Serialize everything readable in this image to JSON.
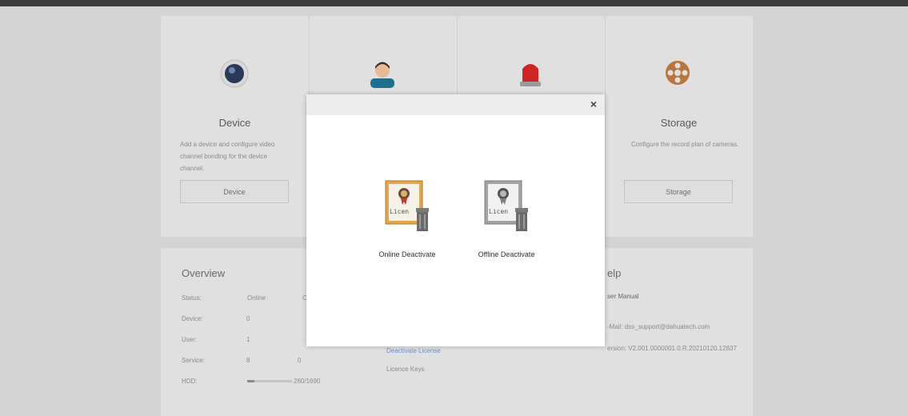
{
  "cards": [
    {
      "title": "Device",
      "desc": "Add a device and configure video channel bonding for the device channel.",
      "button": "Device",
      "icon": "camera-icon"
    },
    {
      "title": "",
      "desc": "",
      "button": "",
      "icon": "user-icon"
    },
    {
      "title": "",
      "desc": "",
      "button": "",
      "icon": "alarm-icon"
    },
    {
      "title": "Storage",
      "desc": "Configure the record plan of cameras.",
      "button": "Storage",
      "icon": "film-reel-icon"
    }
  ],
  "overview": {
    "title": "Overview",
    "col_online": "Online",
    "col_offline": "O",
    "rows": [
      {
        "label": "Status:",
        "v1": "",
        "v2": ""
      },
      {
        "label": "Device:",
        "v1": "0",
        "v2": ""
      },
      {
        "label": "User:",
        "v1": "1",
        "v2": ""
      },
      {
        "label": "Service:",
        "v1": "8",
        "v2": "0"
      },
      {
        "label": "HDD:",
        "v1": "",
        "v2": ""
      }
    ],
    "hdd_text": "260/1690",
    "hdd_fraction": 0.154
  },
  "license": {
    "deactivate": "Deactivate License",
    "keys": "Licence Keys"
  },
  "help": {
    "title": "elp",
    "manual": "ser Manual",
    "email_label": "-Mail:",
    "email": "dss_support@dahuatech.com",
    "version_label": "ersion:",
    "version": "V2.001.0000001.0.R.20210120.12837"
  },
  "modal": {
    "close_label": "×",
    "online_label": "Online Deactivate",
    "offline_label": "Offline Deactivate",
    "icon_text": "Licen"
  }
}
